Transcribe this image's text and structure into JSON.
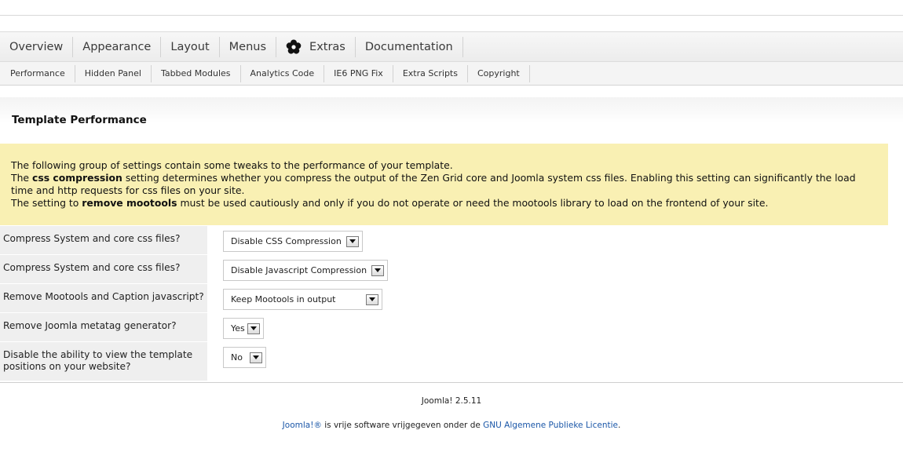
{
  "main_tabs": [
    {
      "label": "Overview"
    },
    {
      "label": "Appearance"
    },
    {
      "label": "Layout"
    },
    {
      "label": "Menus"
    },
    {
      "label": "Extras",
      "icon": "flower-icon"
    },
    {
      "label": "Documentation"
    }
  ],
  "sub_tabs": [
    {
      "label": "Performance"
    },
    {
      "label": "Hidden Panel"
    },
    {
      "label": "Tabbed Modules"
    },
    {
      "label": "Analytics Code"
    },
    {
      "label": "IE6 PNG Fix"
    },
    {
      "label": "Extra Scripts"
    },
    {
      "label": "Copyright"
    }
  ],
  "page_title": "Template Performance",
  "notice": {
    "line1": "The following group of settings contain some tweaks to the performance of your template.",
    "line2_prefix": "The ",
    "line2_bold": "css compression",
    "line2_rest": " setting determines whether you compress the output of the Zen Grid core and Joomla system css files. Enabling this setting can significantly the load time and http requests for css files on your site.",
    "line3_prefix": "The setting to ",
    "line3_bold": "remove mootools",
    "line3_rest": " must be used cautiously and only if you do not operate or need the mootools library to load on the frontend of your site."
  },
  "settings": [
    {
      "label": "Compress System and core css files?",
      "value": "Disable CSS Compression"
    },
    {
      "label": "Compress System and core css files?",
      "value": "Disable Javascript Compression"
    },
    {
      "label": "Remove Mootools and Caption javascript?",
      "value": "Keep Mootools in output"
    },
    {
      "label": "Remove Joomla metatag generator?",
      "value": "Yes"
    },
    {
      "label": "Disable the ability to view the template positions on your website?",
      "value": "No"
    }
  ],
  "footer": {
    "version": "Joomla! 2.5.11",
    "link1": "Joomla!®",
    "middle": " is vrije software vrijgegeven onder de ",
    "link2": "GNU Algemene Publieke Licentie",
    "end": "."
  },
  "colors": {
    "notice_bg": "#f9f0b3",
    "label_bg": "#efefef",
    "link": "#1b57a8"
  }
}
